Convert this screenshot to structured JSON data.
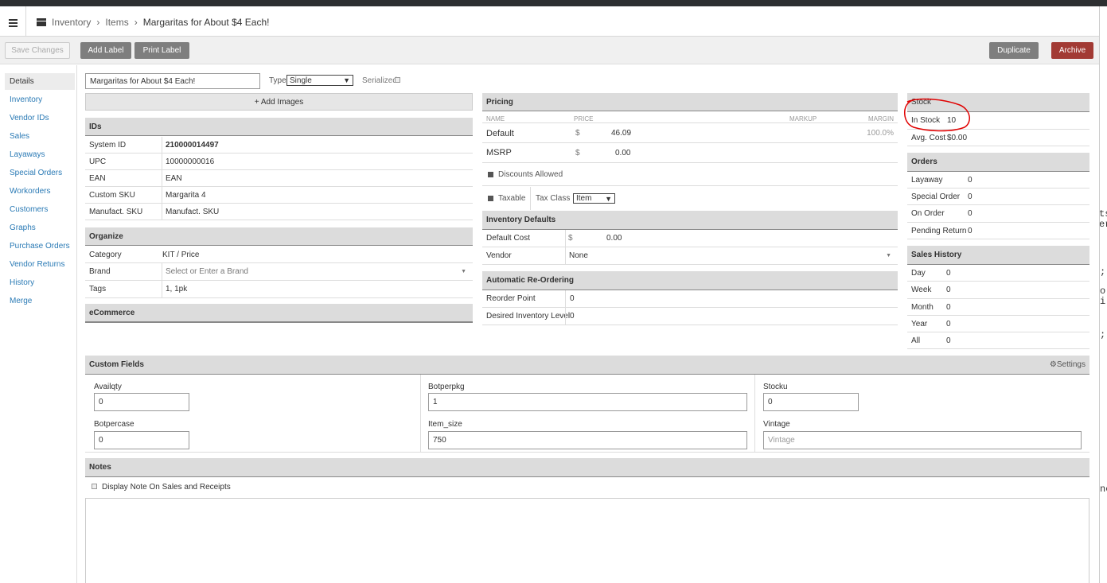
{
  "header": {
    "breadcrumb": {
      "root": "Inventory",
      "sep": "›",
      "section": "Items",
      "current": "Margaritas for About $4 Each!"
    }
  },
  "toolbar": {
    "save_changes": "Save Changes",
    "add_label": "Add Label",
    "print_label": "Print Label",
    "duplicate": "Duplicate",
    "archive": "Archive"
  },
  "sidebar": {
    "items": [
      "Details",
      "Inventory",
      "Vendor IDs",
      "Sales",
      "Layaways",
      "Special Orders",
      "Workorders",
      "Customers",
      "Graphs",
      "Purchase Orders",
      "Vendor Returns",
      "History",
      "Merge"
    ]
  },
  "item": {
    "name": "Margaritas for About $4 Each!",
    "type_label": "Type",
    "type_value": "Single",
    "serialized_label": "Serialized",
    "add_images": "+ Add Images"
  },
  "ids": {
    "title": "IDs",
    "system_id_label": "System ID",
    "system_id": "210000014497",
    "upc_label": "UPC",
    "upc": "10000000016",
    "ean_label": "EAN",
    "ean_placeholder": "EAN",
    "custom_sku_label": "Custom SKU",
    "custom_sku": "Margarita 4",
    "manufact_sku_label": "Manufact. SKU",
    "manufact_sku_placeholder": "Manufact. SKU"
  },
  "organize": {
    "title": "Organize",
    "category_label": "Category",
    "category": "KIT / Price",
    "brand_label": "Brand",
    "brand_placeholder": "Select or Enter a Brand",
    "tags_label": "Tags",
    "tags": "1, 1pk"
  },
  "ecommerce": {
    "title": "eCommerce"
  },
  "pricing": {
    "title": "Pricing",
    "col_name": "NAME",
    "col_price": "PRICE",
    "col_markup": "MARKUP",
    "col_margin": "MARGIN",
    "default_label": "Default",
    "default_currency": "$",
    "default_price": "46.09",
    "default_margin": "100.0%",
    "msrp_label": "MSRP",
    "msrp_currency": "$",
    "msrp_price": "0.00",
    "discounts_allowed": "Discounts Allowed",
    "taxable": "Taxable",
    "tax_class_label": "Tax Class",
    "tax_class_value": "Item"
  },
  "inventory_defaults": {
    "title": "Inventory Defaults",
    "default_cost_label": "Default Cost",
    "default_cost_currency": "$",
    "default_cost": "0.00",
    "vendor_label": "Vendor",
    "vendor": "None"
  },
  "reordering": {
    "title": "Automatic Re-Ordering",
    "reorder_point_label": "Reorder Point",
    "reorder_point": "0",
    "desired_level_label": "Desired Inventory Level",
    "desired_level": "0"
  },
  "stock": {
    "title": "Stock",
    "in_stock_label": "In Stock",
    "in_stock": "10",
    "avg_cost_label": "Avg. Cost",
    "avg_cost": "$0.00"
  },
  "orders": {
    "title": "Orders",
    "rows": [
      {
        "label": "Layaway",
        "value": "0"
      },
      {
        "label": "Special Order",
        "value": "0"
      },
      {
        "label": "On Order",
        "value": "0"
      },
      {
        "label": "Pending Return",
        "value": "0"
      }
    ]
  },
  "sales_history": {
    "title": "Sales History",
    "rows": [
      {
        "label": "Day",
        "value": "0"
      },
      {
        "label": "Week",
        "value": "0"
      },
      {
        "label": "Month",
        "value": "0"
      },
      {
        "label": "Year",
        "value": "0"
      },
      {
        "label": "All",
        "value": "0"
      }
    ]
  },
  "custom_fields": {
    "title": "Custom Fields",
    "settings": "Settings",
    "availqty_label": "Availqty",
    "availqty": "0",
    "botperpkg_label": "Botperpkg",
    "botperpkg": "1",
    "stocku_label": "Stocku",
    "stocku": "0",
    "botpercase_label": "Botpercase",
    "botpercase": "0",
    "item_size_label": "Item_size",
    "item_size": "750",
    "vintage_label": "Vintage",
    "vintage_placeholder": "Vintage"
  },
  "notes": {
    "title": "Notes",
    "display_note": "Display Note On Sales and Receipts"
  },
  "edge_glyphs": [
    "ts",
    "er",
    ";",
    "o",
    "i",
    ";",
    "ne"
  ],
  "colors": {
    "link": "#2a7ab5",
    "archive": "#a23a34",
    "button_gray": "#7e7e7e",
    "annotation": "#e00000"
  }
}
